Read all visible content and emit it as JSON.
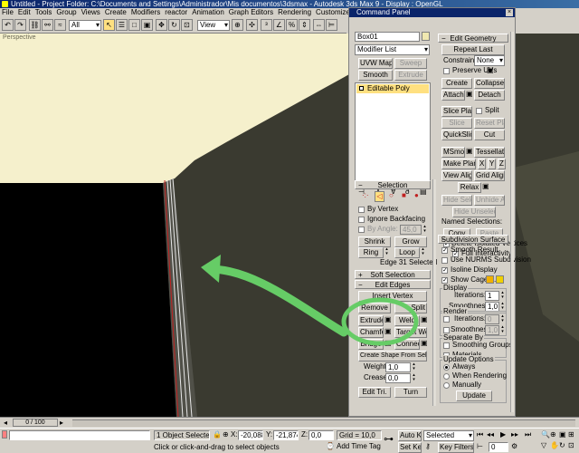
{
  "window": {
    "title": "Untitled    - Project Folder: C:\\Documents and Settings\\Administrador\\Mis documentos\\3dsmax    - Autodesk 3ds Max 9    - Display : OpenGL"
  },
  "menu": [
    "File",
    "Edit",
    "Tools",
    "Group",
    "Views",
    "Create",
    "Modifiers",
    "reactor",
    "Animation",
    "Graph Editors",
    "Rendering",
    "Customize",
    "MAXScript",
    "Help"
  ],
  "toolbar": {
    "selection_filter": "All",
    "ref_coord": "View"
  },
  "viewport": {
    "label": "Perspective"
  },
  "command_panel": {
    "title": "Command Panel",
    "object_name": "Box01",
    "modifier_list": "Modifier List",
    "mod_buttons": [
      "UVW Map",
      "Sweep",
      "Smooth",
      "Extrude"
    ],
    "stack_item": "Editable Poly",
    "selection": {
      "header": "Selection",
      "by_vertex": "By Vertex",
      "ignore_backfacing": "Ignore Backfacing",
      "by_angle": "By Angle:",
      "by_angle_value": "45,0",
      "shrink": "Shrink",
      "grow": "Grow",
      "ring": "Ring",
      "loop": "Loop",
      "status": "Edge 31 Selected"
    },
    "soft_selection": {
      "header": "Soft Selection"
    },
    "edit_edges": {
      "header": "Edit Edges",
      "insert_vertex": "Insert Vertex",
      "remove": "Remove",
      "split": "Split",
      "extrude": "Extrude",
      "weld": "Weld",
      "chamfer": "Chamfer",
      "target_weld": "Target Weld",
      "bridge": "Bridge",
      "connect": "Connect",
      "create_shape": "Create Shape From Selection",
      "weight": "Weight:",
      "weight_value": "1,0",
      "crease": "Crease:",
      "crease_value": "0,0",
      "edit_tri": "Edit Tri.",
      "turn": "Turn"
    },
    "edit_geometry": {
      "header": "Edit Geometry",
      "repeat_last": "Repeat Last",
      "constraints": "Constraints:",
      "constraints_value": "None",
      "preserve_uvs": "Preserve UVs",
      "create": "Create",
      "collapse": "Collapse",
      "attach": "Attach",
      "detach": "Detach",
      "slice_plane": "Slice Plane",
      "split": "Split",
      "slice": "Slice",
      "reset_plane": "Reset Plane",
      "quickslice": "QuickSlice",
      "cut": "Cut",
      "msmooth": "MSmooth",
      "tessellate": "Tessellate",
      "make_planar": "Make Planar",
      "x": "X",
      "y": "Y",
      "z": "Z",
      "view_align": "View Align",
      "grid_align": "Grid Align",
      "relax": "Relax",
      "hide_selected": "Hide Selected",
      "unhide_all": "Unhide All",
      "hide_unselected": "Hide Unselected",
      "named_selections": "Named Selections:",
      "copy": "Copy",
      "paste": "Paste",
      "delete_isolated": "Delete Isolated Vertices",
      "full_interactivity": "Full Interactivity"
    },
    "subdivision": {
      "header": "Subdivision Surface",
      "smooth_result": "Smooth Result",
      "use_nurms": "Use NURMS Subdivision",
      "isoline": "Isoline Display",
      "show_cage": "Show Cage......",
      "display": "Display",
      "iterations": "Iterations:",
      "iterations_value": "1",
      "smoothness": "Smoothness:",
      "smoothness_value": "1,0",
      "render": "Render",
      "r_iterations": "Iterations:",
      "r_iterations_value": "0",
      "r_smoothness": "Smoothness:",
      "r_smoothness_value": "1,0",
      "separate_by": "Separate By",
      "smoothing_groups": "Smoothing Groups",
      "materials": "Materials",
      "update_options": "Update Options",
      "always": "Always",
      "when_rendering": "When Rendering",
      "manually": "Manually",
      "update": "Update"
    }
  },
  "timeline": {
    "frame": "0 / 100"
  },
  "status": {
    "selected": "1 Object Selected",
    "x_label": "X:",
    "x": "-20,088",
    "y_label": "Y:",
    "y": "-21,874",
    "z_label": "Z:",
    "z": "0,0",
    "grid": "Grid = 10,0",
    "add_time_tag": "Add Time Tag",
    "auto_key": "Auto Key",
    "set_key": "Set Key",
    "key_mode": "Selected",
    "key_filters": "Key Filters...",
    "prompt": "Click or click-and-drag to select objects",
    "frame_value": "0"
  },
  "colors": {
    "accent": "#ffe080",
    "titlebar": "#0a246a",
    "annotation": "#66cc66",
    "cage_swatch": "#f0b000"
  }
}
